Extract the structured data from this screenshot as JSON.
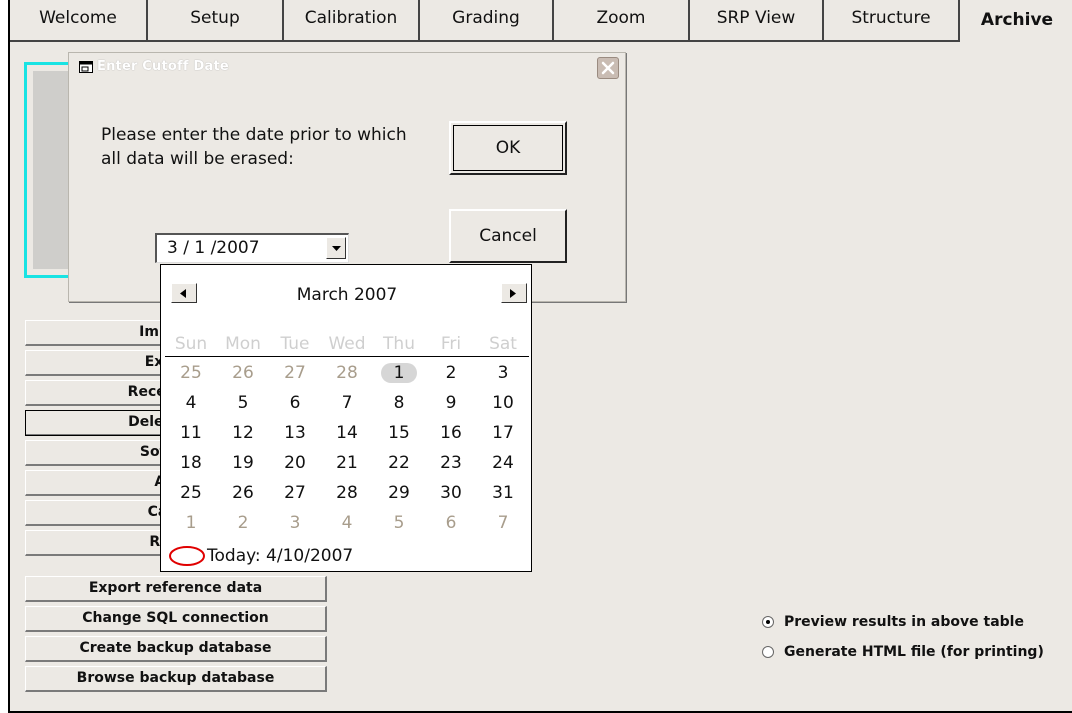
{
  "tabs": [
    {
      "label": "Welcome",
      "active": false
    },
    {
      "label": "Setup",
      "active": false
    },
    {
      "label": "Calibration",
      "active": false
    },
    {
      "label": "Grading",
      "active": false
    },
    {
      "label": "Zoom",
      "active": false
    },
    {
      "label": "SRP View",
      "active": false
    },
    {
      "label": "Structure",
      "active": false
    },
    {
      "label": "Archive",
      "active": true
    }
  ],
  "side_buttons": [
    {
      "label": "Import in"
    },
    {
      "label": "Export i"
    },
    {
      "label": "Recent repo"
    },
    {
      "label": "Delete prior",
      "focused": true
    },
    {
      "label": "Software"
    },
    {
      "label": "Audit"
    },
    {
      "label": "Calibra"
    },
    {
      "label": "Refere"
    },
    {
      "label": "Export reference data"
    },
    {
      "label": "Change SQL connection"
    },
    {
      "label": "Create backup database"
    },
    {
      "label": "Browse backup database"
    }
  ],
  "output_options": [
    {
      "label": "Preview results in above table",
      "selected": true
    },
    {
      "label": "Generate HTML file (for printing)",
      "selected": false
    }
  ],
  "dialog": {
    "title": "Enter Cutoff Date",
    "message": "Please enter the date prior to which all data will be erased:",
    "ok_label": "OK",
    "cancel_label": "Cancel",
    "date_value": "3 / 1 /2007"
  },
  "calendar": {
    "month_label": "March 2007",
    "weekdays": [
      "Sun",
      "Mon",
      "Tue",
      "Wed",
      "Thu",
      "Fri",
      "Sat"
    ],
    "weeks": [
      [
        {
          "d": "25",
          "o": true
        },
        {
          "d": "26",
          "o": true
        },
        {
          "d": "27",
          "o": true
        },
        {
          "d": "28",
          "o": true
        },
        {
          "d": "1",
          "o": false,
          "sel": true
        },
        {
          "d": "2",
          "o": false
        },
        {
          "d": "3",
          "o": false
        }
      ],
      [
        {
          "d": "4"
        },
        {
          "d": "5"
        },
        {
          "d": "6"
        },
        {
          "d": "7"
        },
        {
          "d": "8"
        },
        {
          "d": "9"
        },
        {
          "d": "10"
        }
      ],
      [
        {
          "d": "11"
        },
        {
          "d": "12"
        },
        {
          "d": "13"
        },
        {
          "d": "14"
        },
        {
          "d": "15"
        },
        {
          "d": "16"
        },
        {
          "d": "17"
        }
      ],
      [
        {
          "d": "18"
        },
        {
          "d": "19"
        },
        {
          "d": "20"
        },
        {
          "d": "21"
        },
        {
          "d": "22"
        },
        {
          "d": "23"
        },
        {
          "d": "24"
        }
      ],
      [
        {
          "d": "25"
        },
        {
          "d": "26"
        },
        {
          "d": "27"
        },
        {
          "d": "28"
        },
        {
          "d": "29"
        },
        {
          "d": "30"
        },
        {
          "d": "31"
        }
      ],
      [
        {
          "d": "1",
          "o": true
        },
        {
          "d": "2",
          "o": true
        },
        {
          "d": "3",
          "o": true
        },
        {
          "d": "4",
          "o": true
        },
        {
          "d": "5",
          "o": true
        },
        {
          "d": "6",
          "o": true
        },
        {
          "d": "7",
          "o": true
        }
      ]
    ],
    "today_label": "Today: 4/10/2007"
  },
  "colors": {
    "accent_cyan": "#19e3e3",
    "today_circle": "#e00000",
    "window_bg": "#ece9e4"
  },
  "icons": {
    "title_icon": "window-icon",
    "close_icon": "close-icon",
    "dropdown_icon": "chevron-down-icon",
    "prev_icon": "arrow-left-icon",
    "next_icon": "arrow-right-icon",
    "today_icon": "today-circle-icon"
  }
}
